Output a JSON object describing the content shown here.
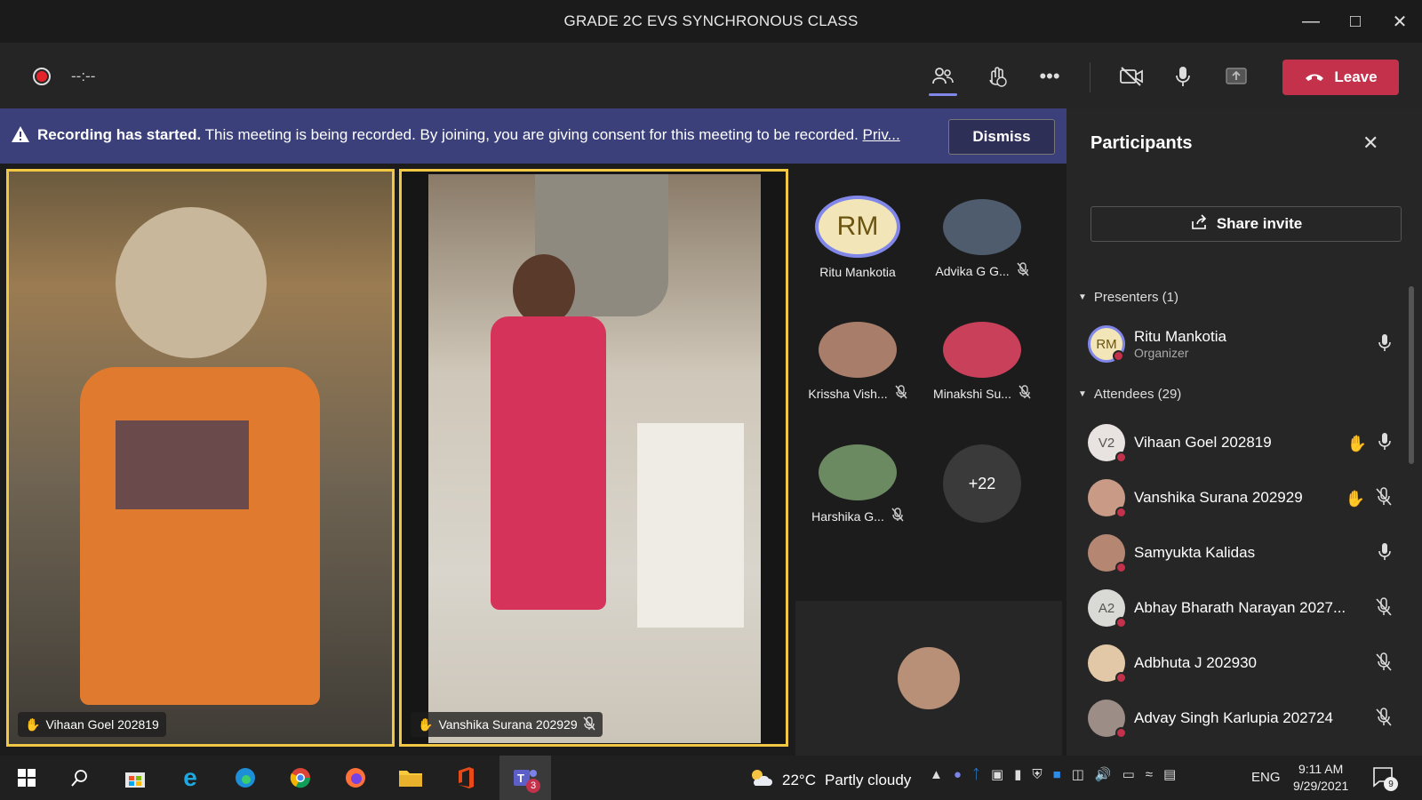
{
  "window": {
    "title": "GRADE 2C EVS SYNCHRONOUS CLASS"
  },
  "toolbar": {
    "timer": "--:--",
    "leave_label": "Leave"
  },
  "banner": {
    "bold": "Recording has started.",
    "message": " This meeting is being recorded. By joining, you are giving consent for this meeting to be recorded. ",
    "link": "Priv...",
    "dismiss_label": "Dismiss"
  },
  "videos": [
    {
      "name": "Vihaan Goel 202819"
    },
    {
      "name": "Vanshika Surana 202929"
    }
  ],
  "gallery": {
    "tiles": [
      {
        "initials": "RM",
        "name": "Ritu Mankotia"
      },
      {
        "name": "Advika G G..."
      },
      {
        "name": "Krissha Vish..."
      },
      {
        "name": "Minakshi Su..."
      },
      {
        "name": "Harshika G..."
      }
    ],
    "more_count": "+22"
  },
  "panel": {
    "title": "Participants",
    "share_label": "Share invite",
    "presenters_label": "Presenters (1)",
    "attendees_label": "Attendees (29)",
    "presenters": [
      {
        "initials": "RM",
        "name": "Ritu Mankotia",
        "role": "Organizer"
      }
    ],
    "attendees": [
      {
        "initials": "V2",
        "name": "Vihaan Goel 202819"
      },
      {
        "name": "Vanshika Surana 202929"
      },
      {
        "name": "Samyukta Kalidas"
      },
      {
        "initials": "A2",
        "name": "Abhay Bharath Narayan 2027..."
      },
      {
        "name": "Adbhuta J 202930"
      },
      {
        "name": "Advay Singh Karlupia 202724"
      }
    ]
  },
  "taskbar": {
    "temperature": "22°C",
    "weather": "Partly cloudy",
    "language": "ENG",
    "time": "9:11 AM",
    "date": "9/29/2021",
    "teams_badge": "3",
    "notif_count": "9"
  },
  "colors": {
    "leave": "#c4314b",
    "banner": "#3b3f7a",
    "active_border": "#f2c744",
    "raised_hand": "#f5b82e"
  }
}
